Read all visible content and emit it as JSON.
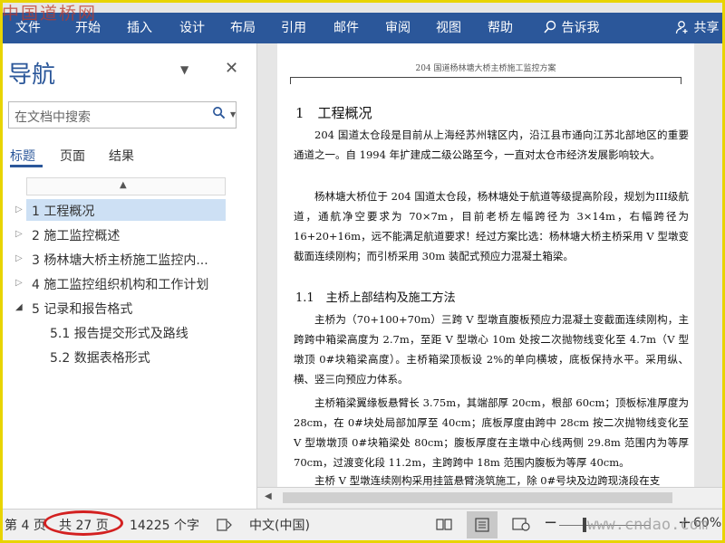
{
  "watermark_top": "中国道桥网",
  "ribbon": {
    "tabs": [
      "文件",
      "开始",
      "插入",
      "设计",
      "布局",
      "引用",
      "邮件",
      "审阅",
      "视图",
      "帮助"
    ],
    "tell_me": "告诉我",
    "share": "共享"
  },
  "nav": {
    "title": "导航",
    "search_placeholder": "在文档中搜索",
    "tabs": [
      "标题",
      "页面",
      "结果"
    ],
    "headings": [
      {
        "label": "1 工程概况",
        "level": 1,
        "selected": true
      },
      {
        "label": "2 施工监控概述",
        "level": 1,
        "selected": false
      },
      {
        "label": "3 杨林塘大桥主桥施工监控内...",
        "level": 1,
        "selected": false
      },
      {
        "label": "4 施工监控组织机构和工作计划",
        "level": 1,
        "selected": false
      },
      {
        "label": "5 记录和报告格式",
        "level": 1,
        "selected": false
      },
      {
        "label": "5.1 报告提交形式及路线",
        "level": 2,
        "selected": false
      },
      {
        "label": "5.2 数据表格形式",
        "level": 2,
        "selected": false
      }
    ]
  },
  "document": {
    "header": "204 国道杨林塘大桥主桥施工监控方案",
    "h1": "1　工程概况",
    "p1": "204 国道太仓段是目前从上海经苏州辖区内，沿江县市通向江苏北部地区的重要通道之一。自 1994 年扩建成二级公路至今，一直对太仓市经济发展影响较大。",
    "p2": "杨林塘大桥位于 204 国道太仓段，杨林塘处于航道等级提高阶段，规划为III级航道，通航净空要求为 70×7m，目前老桥左幅跨径为 3×14m，右幅跨径为 16+20+16m，远不能满足航道要求！经过方案比选：杨林塘大桥主桥采用 V 型墩变截面连续刚构；而引桥采用 30m 装配式预应力混凝土箱梁。",
    "h2": "1.1　主桥上部结构及施工方法",
    "p3": "主桥为（70+100+70m）三跨 V 型墩直腹板预应力混凝土变截面连续刚构，主跨跨中箱梁高度为 2.7m，至距 V 型墩心 10m 处按二次抛物线变化至 4.7m（V 型墩顶 0#块箱梁高度）。主桥箱梁顶板设 2%的单向横坡，底板保持水平。采用纵、横、竖三向预应力体系。",
    "p4": "主桥箱梁翼缘板悬臂长 3.75m，其端部厚 20cm，根部 60cm；顶板标准厚度为 28cm，在 0#块处局部加厚至 40cm；底板厚度由跨中 28cm 按二次抛物线变化至 V 型墩墩顶 0#块箱梁处 80cm；腹板厚度在主墩中心线两侧 29.8m 范围内为等厚 70cm，过渡变化段 11.2m，主跨跨中 18m 范围内腹板为等厚 40cm。",
    "p5": "主桥 V 型墩连续刚构采用挂篮悬臂浇筑施工，除 0#号块及边跨现浇段在支"
  },
  "status": {
    "page_of": "第 4 页",
    "total_pages": "共 27 页",
    "word_count": "14225 个字",
    "language": "中文(中国)",
    "zoom_minus": "−",
    "zoom_plus": "+",
    "zoom": "60%",
    "zoom_level": 0.6
  },
  "watermark_bottom": "www.cndao.com",
  "colors": {
    "ribbon": "#2b579a",
    "frame": "#e8d400",
    "highlight_oval": "#d32020",
    "nav_selected": "#cde0f4"
  }
}
